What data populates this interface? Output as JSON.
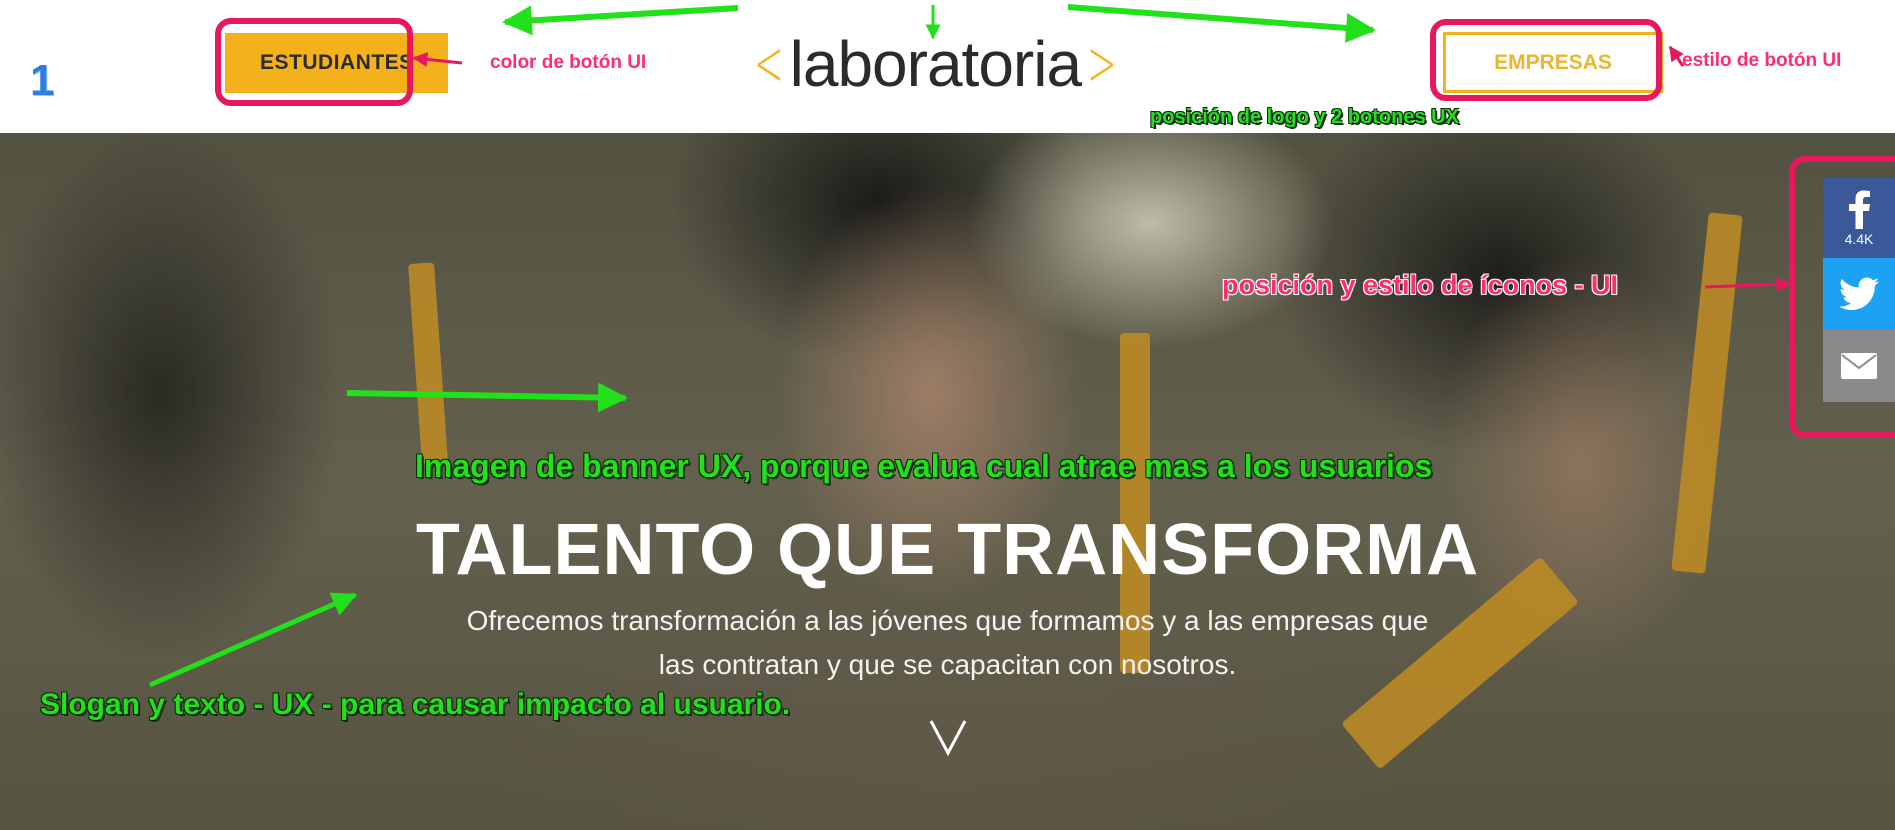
{
  "header": {
    "page_number": "1",
    "estudiantes_label": "ESTUDIANTES",
    "empresas_label": "EMPRESAS",
    "logo": {
      "left_bracket": "<",
      "word": "laboratoria",
      "right_bracket": ">"
    }
  },
  "hero": {
    "title": "TALENTO QUE TRANSFORMA",
    "subtitle_line1": "Ofrecemos transformación a las jóvenes que formamos y a las empresas que",
    "subtitle_line2": "las contratan y que se capacitan con nosotros.",
    "scroll_icon": "chevron-down-icon"
  },
  "social": {
    "facebook_icon": "facebook-icon",
    "facebook_count": "4.4K",
    "twitter_icon": "twitter-icon",
    "email_icon": "email-icon"
  },
  "annotations": {
    "boton_color": "color de botón UI",
    "boton_estilo": "estilo de botón UI",
    "logo_posicion": "posición de logo y 2 botones UX",
    "iconos": "posición y estilo de íconos - UI",
    "banner": "Imagen de banner UX, porque evalua cual atrae mas a los usuarios",
    "slogan": "Slogan y texto - UX - para causar impacto al usuario."
  },
  "colors": {
    "brand_yellow": "#f3b21b",
    "annotation_pink": "#e8185e",
    "annotation_green": "#22e01a",
    "facebook": "#3b5998",
    "twitter": "#1da1f2",
    "email": "#8a8a8a"
  }
}
